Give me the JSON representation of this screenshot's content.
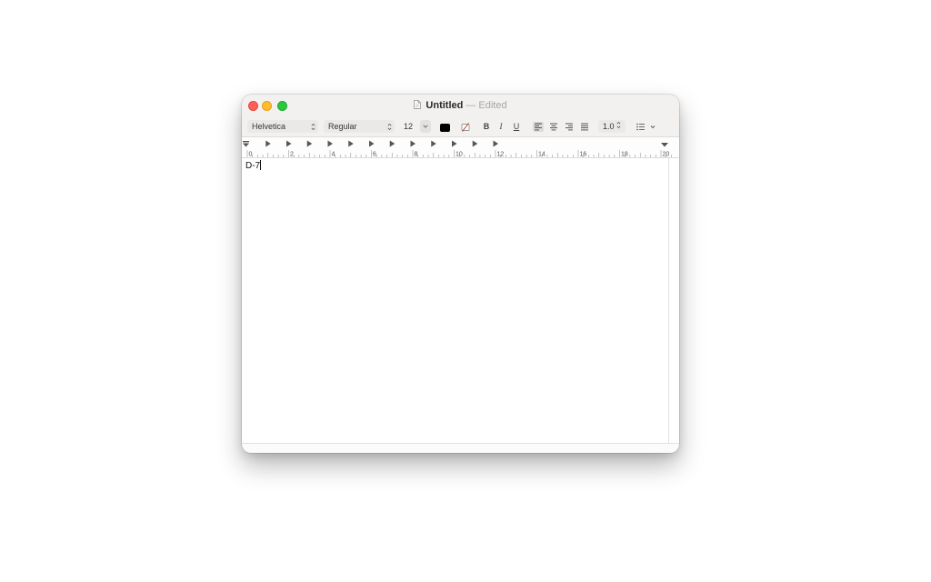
{
  "window": {
    "title": "Untitled",
    "separator": "—",
    "status": "Edited"
  },
  "toolbar": {
    "font_family": "Helvetica",
    "font_style": "Regular",
    "font_size": "12",
    "text_color": "#000000",
    "bold_label": "B",
    "italic_label": "I",
    "underline_label": "U",
    "line_spacing": "1.0",
    "popup_arrows": "⌃⌄",
    "dropdown_arrow": "⌄"
  },
  "ruler": {
    "labels": [
      "0",
      "2",
      "4",
      "6",
      "8",
      "10",
      "12",
      "14",
      "16",
      "18",
      "20"
    ]
  },
  "document": {
    "text": "D-7"
  },
  "colors": {
    "close": "#fe5f57",
    "minimize": "#febc2e",
    "zoom": "#28c840"
  }
}
